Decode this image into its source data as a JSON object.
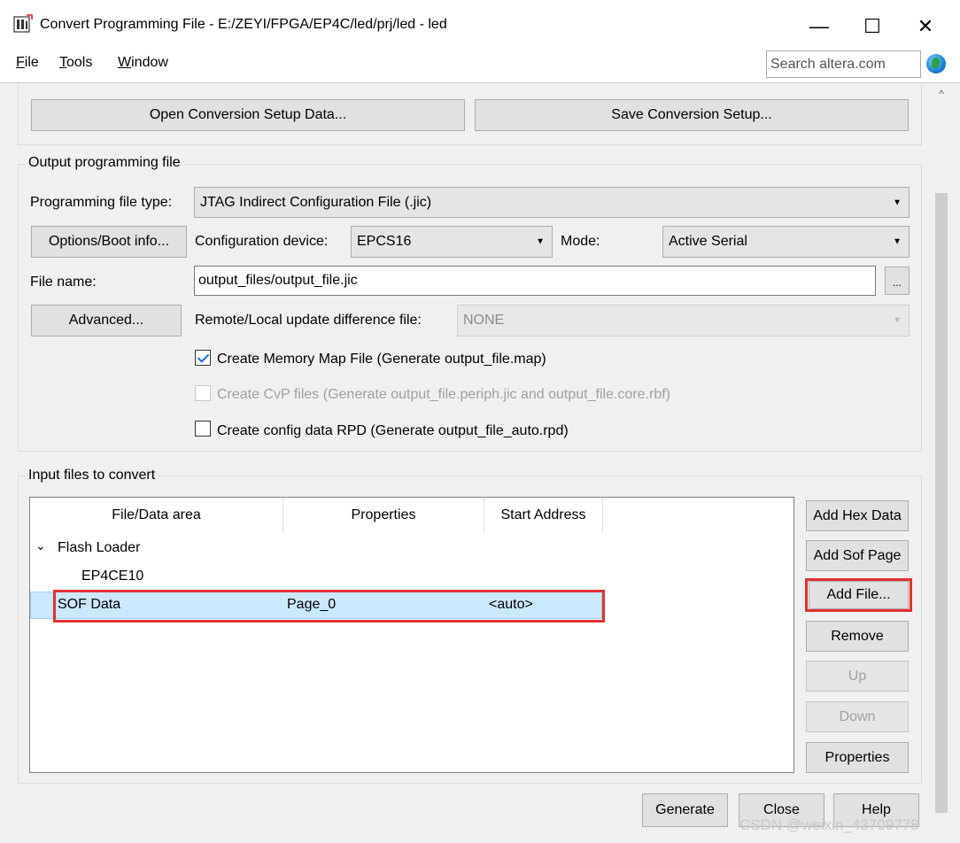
{
  "window": {
    "title": "Convert Programming File - E:/ZEYI/FPGA/EP4C/led/prj/led - led",
    "minimize_glyph": "—",
    "maximize_glyph": "☐",
    "close_glyph": "✕"
  },
  "menu": {
    "items": [
      {
        "label": "File",
        "accel": "F",
        "rest": "ile"
      },
      {
        "label": "Tools",
        "accel": "T",
        "rest": "ools"
      },
      {
        "label": "Window",
        "accel": "W",
        "rest": "indow"
      }
    ],
    "search_placeholder": "Search altera.com",
    "globe_icon": "globe-icon"
  },
  "setup_buttons": {
    "open": "Open Conversion Setup Data...",
    "save": "Save Conversion Setup..."
  },
  "output_group": {
    "title": "Output programming file",
    "file_type_label": "Programming file type:",
    "file_type_value": "JTAG Indirect Configuration File (.jic)",
    "options_button": "Options/Boot info...",
    "config_device_label": "Configuration device:",
    "config_device_value": "EPCS16",
    "mode_label": "Mode:",
    "mode_value": "Active Serial",
    "file_name_label": "File name:",
    "file_name_value": "output_files/output_file.jic",
    "browse_button": "...",
    "advanced_button": "Advanced...",
    "remote_label": "Remote/Local update difference file:",
    "remote_value": "NONE",
    "checkboxes": [
      {
        "label": "Create Memory Map File (Generate output_file.map)",
        "checked": true,
        "disabled": false
      },
      {
        "label": "Create CvP files (Generate output_file.periph.jic and output_file.core.rbf)",
        "checked": false,
        "disabled": true
      },
      {
        "label": "Create config data RPD (Generate output_file_auto.rpd)",
        "checked": false,
        "disabled": false
      }
    ]
  },
  "input_group": {
    "title": "Input files to convert",
    "columns": [
      "File/Data area",
      "Properties",
      "Start Address"
    ],
    "tree": {
      "root": "Flash Loader",
      "child": "EP4CE10",
      "selected_row": {
        "name": "SOF Data",
        "properties": "Page_0",
        "start_address": "<auto>"
      }
    },
    "side_buttons": [
      {
        "label": "Add Hex Data",
        "disabled": false
      },
      {
        "label": "Add Sof Page",
        "disabled": false
      },
      {
        "label": "Add File...",
        "disabled": false
      },
      {
        "label": "Remove",
        "disabled": false
      },
      {
        "label": "Up",
        "disabled": true
      },
      {
        "label": "Down",
        "disabled": true
      },
      {
        "label": "Properties",
        "disabled": false
      }
    ]
  },
  "bottom_buttons": {
    "generate": "Generate",
    "close": "Close",
    "help": "Help"
  },
  "watermark": "CSDN @weixin_43709778"
}
